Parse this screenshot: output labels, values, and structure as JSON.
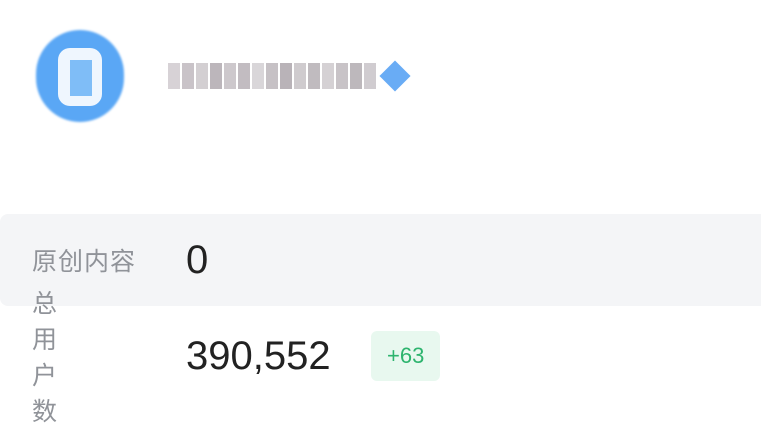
{
  "account": {
    "avatar_icon": "account-avatar-icon",
    "name_redacted": true
  },
  "stats": {
    "original_content": {
      "label": "原创内容",
      "value": "0"
    },
    "total_users": {
      "label": "总用户数",
      "value": "390,552",
      "delta": "+63"
    }
  },
  "colors": {
    "accent_blue": "#5aa7f5",
    "delta_green": "#2db46e",
    "delta_bg": "#e8f8ef",
    "label_gray": "#909399"
  }
}
